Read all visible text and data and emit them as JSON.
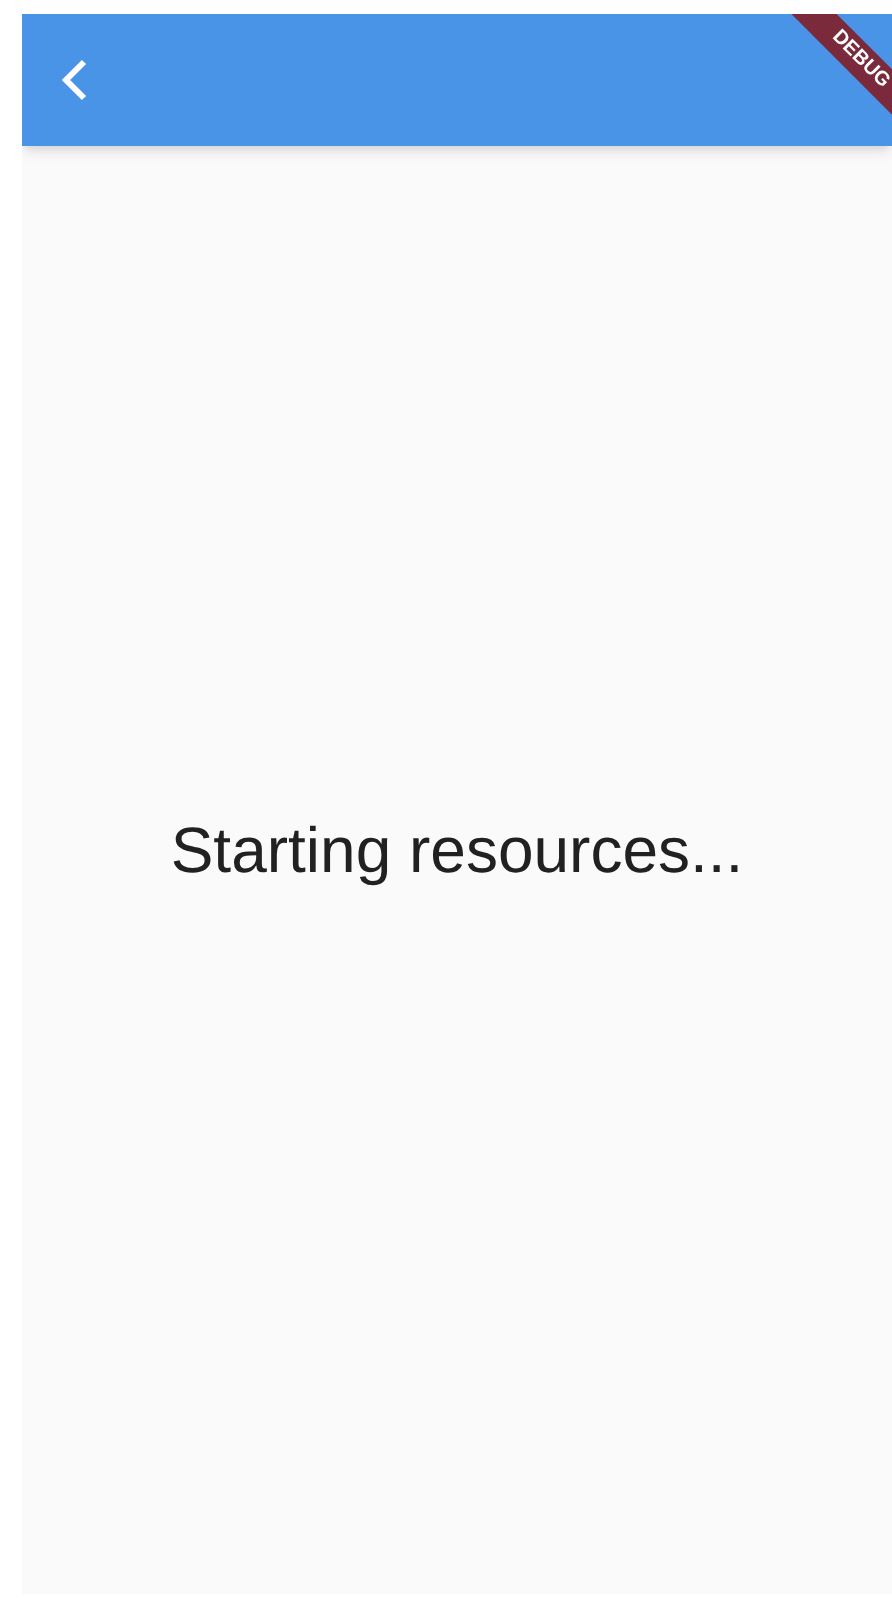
{
  "app_bar": {
    "banner": "DEBUG"
  },
  "message": "Starting resources..."
}
